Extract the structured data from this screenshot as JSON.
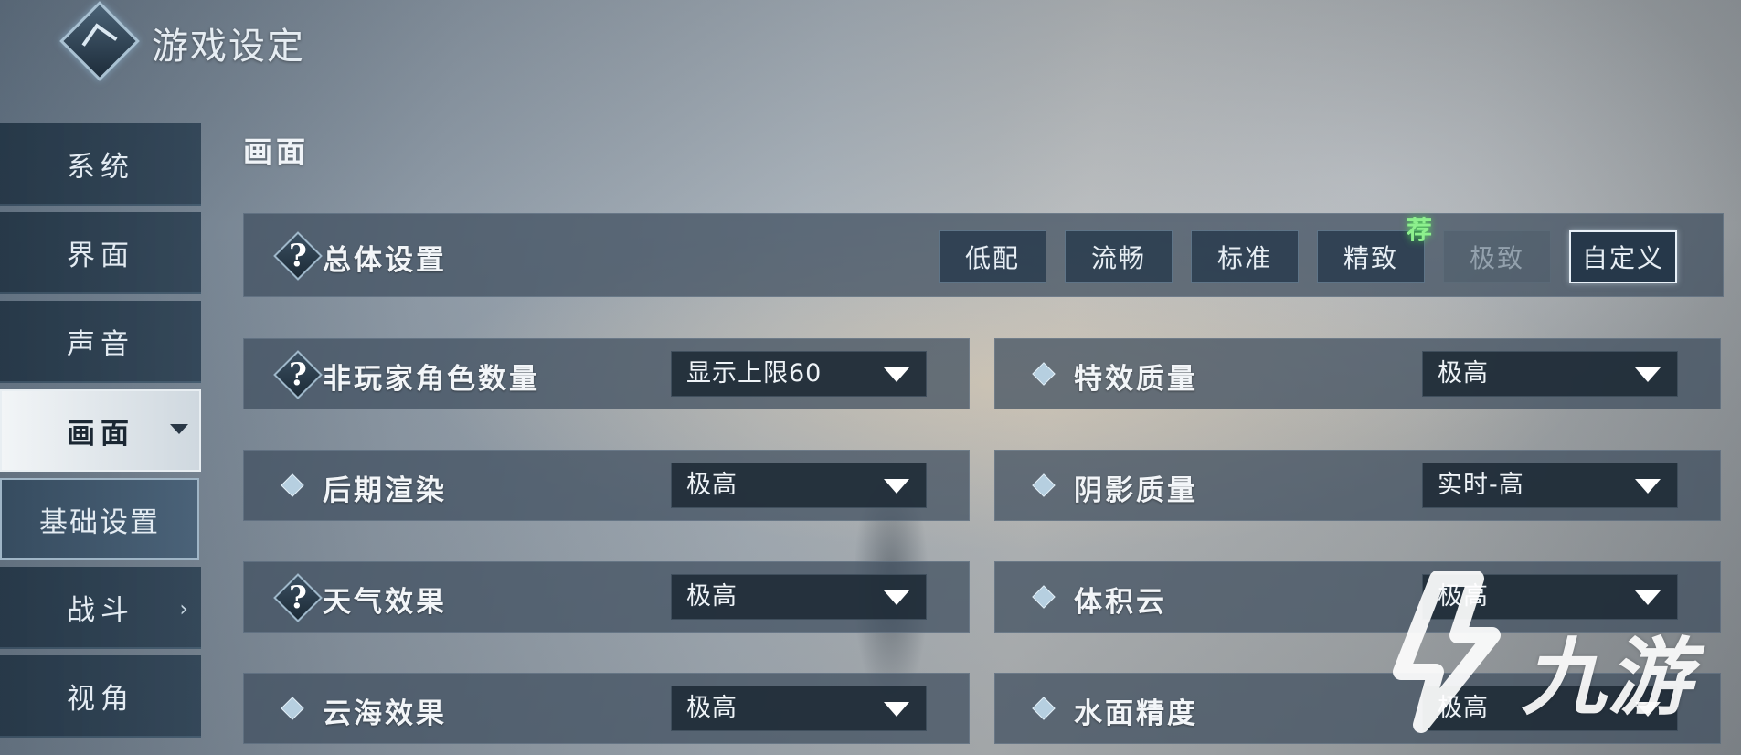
{
  "header": {
    "title": "游戏设定",
    "logo_icon": "diamond-logo-icon"
  },
  "sidebar": {
    "items": [
      {
        "label": "系统"
      },
      {
        "label": "界面"
      },
      {
        "label": "声音"
      },
      {
        "label": "画面",
        "expanded": true
      },
      {
        "label": "基础设置",
        "sub": true,
        "selected": true
      },
      {
        "label": "战斗",
        "has_children": true
      },
      {
        "label": "视角"
      }
    ]
  },
  "main": {
    "section_title": "画面",
    "overall": {
      "label": "总体设置",
      "presets": [
        {
          "label": "低配"
        },
        {
          "label": "流畅"
        },
        {
          "label": "标准"
        },
        {
          "label": "精致",
          "badge": "荐"
        },
        {
          "label": "极致",
          "disabled": true
        },
        {
          "label": "自定义",
          "selected": true
        }
      ]
    },
    "settings": [
      {
        "label": "非玩家角色数量",
        "value": "显示上限60",
        "icon": "question-diamond-icon"
      },
      {
        "label": "特效质量",
        "value": "极高",
        "icon": "diamond-bullet-icon"
      },
      {
        "label": "后期渲染",
        "value": "极高",
        "icon": "diamond-bullet-icon"
      },
      {
        "label": "阴影质量",
        "value": "实时-高",
        "icon": "diamond-bullet-icon"
      },
      {
        "label": "天气效果",
        "value": "极高",
        "icon": "question-diamond-icon"
      },
      {
        "label": "体积云",
        "value": "极高",
        "icon": "diamond-bullet-icon"
      },
      {
        "label": "云海效果",
        "value": "极高",
        "icon": "diamond-bullet-icon"
      },
      {
        "label": "水面精度",
        "value": "极高",
        "icon": "diamond-bullet-icon"
      }
    ]
  },
  "watermark": {
    "text": "九游"
  },
  "colors": {
    "recommend_badge": "#8df08d",
    "panel": "#3e4e5e"
  }
}
